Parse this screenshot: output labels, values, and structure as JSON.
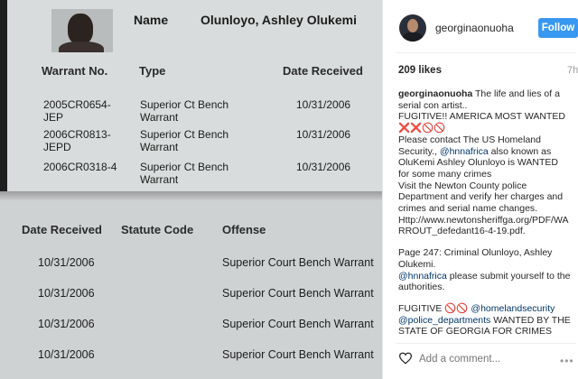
{
  "photo": {
    "name_label": "Name",
    "name_value": "Olunloyo, Ashley Olukemi",
    "top_table": {
      "headers": [
        "Warrant No.",
        "Type",
        "Date Received"
      ],
      "rows": [
        {
          "no": "2005CR0654-\nJEP",
          "type": "Superior Ct Bench\nWarrant",
          "date": "10/31/2006"
        },
        {
          "no": "2006CR0813-\nJEPD",
          "type": "Superior Ct Bench\nWarrant",
          "date": "10/31/2006"
        },
        {
          "no": "2006CR0318-4",
          "type": "Superior Ct Bench\nWarrant",
          "date": "10/31/2006"
        }
      ]
    },
    "bottom_table": {
      "headers": [
        "Date Received",
        "Statute Code",
        "Offense"
      ],
      "rows": [
        {
          "date": "10/31/2006",
          "offense": "Superior Court Bench Warrant"
        },
        {
          "date": "10/31/2006",
          "offense": "Superior Court Bench Warrant"
        },
        {
          "date": "10/31/2006",
          "offense": "Superior Court Bench Warrant"
        },
        {
          "date": "10/31/2006",
          "offense": "Superior Court Bench Warrant"
        }
      ]
    }
  },
  "instagram": {
    "username": "georginaonuoha",
    "follow_label": "Follow",
    "likes": "209 likes",
    "time": "7h",
    "caption": {
      "user": "georginaonuoha",
      "line1": " The life and lies of a serial con artist..",
      "line2": "FUGITIVE!! AMERICA MOST WANTED",
      "emoji": "❌❌🚫🚫",
      "line3a": "Please contact The US Homeland Security., ",
      "mention1": "@hnnafrica",
      "line3b": " also known as OluKemi Ashley Olunloyo is WANTED for some many crimes",
      "line4": "Visit the Newton County police Department and verify her charges and crimes and serial name changes.",
      "line5": "Http://www.newtonsheriffga.org/PDF/WARROUT_defedant16-4-19.pdf.",
      "line6": "Page 247: Criminal Olunloyo, Ashley Olukemi.",
      "mention2": "@hnnafrica",
      "line7": " please submit yourself to the authorities.",
      "line8a": "FUGITIVE ",
      "emoji2": "🚫🚫",
      "mention3": "@homelandsecurity",
      "mention4": "@police_departments",
      "line8b": " WANTED BY THE STATE OF GEORGIA FOR CRIMES AGAINST MINORS AND KIDS"
    },
    "comment_placeholder": "Add a comment...",
    "more_label": "•••"
  },
  "icons": {
    "heart": "heart-icon",
    "more": "more-options-icon",
    "avatar": "avatar"
  },
  "colors": {
    "follow_button": "#3897f0",
    "mention": "#003569"
  }
}
